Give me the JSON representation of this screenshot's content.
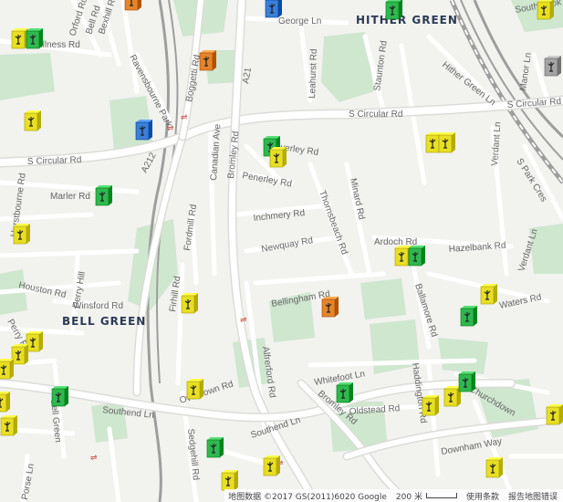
{
  "map": {
    "area_labels": [
      "HITHER GREEN",
      "BELL GREEN"
    ],
    "street_labels": [
      "George Ln",
      "Southbrook",
      "Orford Rd",
      "Bell Rd",
      "Bexhill Rd",
      "Stillness Rd",
      "Ravensbourne Park",
      "Boggetti Rd",
      "A21",
      "Leahurst Rd",
      "Staunton Rd",
      "Hither Green Ln",
      "Manor Ln",
      "S Circular Rd",
      "S Circular Rd",
      "S Circular Rd",
      "Canadian Ave",
      "Bromley Rd",
      "Culverley Rd",
      "Penerley Rd",
      "A212",
      "Hurstbourne Rd",
      "Marler Rd",
      "Inchmery Rd",
      "Newquay Rd",
      "Thornsbeach Rd",
      "Minard Rd",
      "Verdant Ln",
      "S Park Cres",
      "Ardoch Rd",
      "Hazelbank Rd",
      "Fordmill Rd",
      "Perry Hill",
      "Houston Rd",
      "Winsford Rd",
      "Firhill Rd",
      "Bellingham Rd",
      "Ballamore Rd",
      "Waters Rd",
      "Verdant Ln",
      "Perry Ri",
      "Whitefoot Ln",
      "Haddington Rd",
      "Churchdown",
      "Overdown Rd",
      "Alfrerford Rd",
      "Southend Ln",
      "Southend Ln",
      "Bromley Rd",
      "Oldstead Rd",
      "Bell Green",
      "Sedgehill Rd",
      "Downham Way",
      "Porse Ln"
    ]
  },
  "markers": [
    {
      "color": "#e8df25"
    },
    {
      "color": "#2fb84f"
    },
    {
      "color": "#e6842a"
    },
    {
      "color": "#3a7fd8"
    },
    {
      "color": "#2fb84f"
    },
    {
      "color": "#e8df25"
    },
    {
      "color": "#e6842a"
    },
    {
      "color": "#a4a4a4"
    },
    {
      "color": "#e8df25"
    },
    {
      "color": "#3a7fd8"
    },
    {
      "color": "#2fb84f"
    },
    {
      "color": "#e8df25"
    },
    {
      "color": "#e8df25"
    },
    {
      "color": "#e8df25"
    },
    {
      "color": "#e8df25"
    },
    {
      "color": "#2fb84f"
    },
    {
      "color": "#e8df25"
    },
    {
      "color": "#2fb84f"
    },
    {
      "color": "#e8df25"
    },
    {
      "color": "#2fb84f"
    },
    {
      "color": "#e8df25"
    },
    {
      "color": "#e6842a"
    },
    {
      "color": "#e8df25"
    },
    {
      "color": "#e8df25"
    },
    {
      "color": "#e8df25"
    },
    {
      "color": "#e8df25"
    },
    {
      "color": "#e8df25"
    },
    {
      "color": "#2fb84f"
    },
    {
      "color": "#e8df25"
    },
    {
      "color": "#2fb84f"
    },
    {
      "color": "#e8df25"
    },
    {
      "color": "#e8df25"
    },
    {
      "color": "#2fb84f"
    },
    {
      "color": "#2fb84f"
    },
    {
      "color": "#e8df25"
    },
    {
      "color": "#e8df25"
    },
    {
      "color": "#e8df25"
    },
    {
      "color": "#e8df25"
    },
    {
      "color": "#2fb84f"
    },
    {
      "color": "#2fb84f"
    },
    {
      "color": "#d92020"
    },
    {
      "color": "#2fb84f"
    }
  ],
  "colors": {
    "land": "#f2f2ef",
    "park": "#cfe6cf",
    "road": "#ffffff",
    "road_casing": "#dcdcd8",
    "rail": "#9e9e9e"
  },
  "footer": {
    "copyright": "地图数据 ©2017 GS(2011)6020 Google",
    "scale": "200 米",
    "terms": "使用条款",
    "report": "报告地图错误"
  }
}
